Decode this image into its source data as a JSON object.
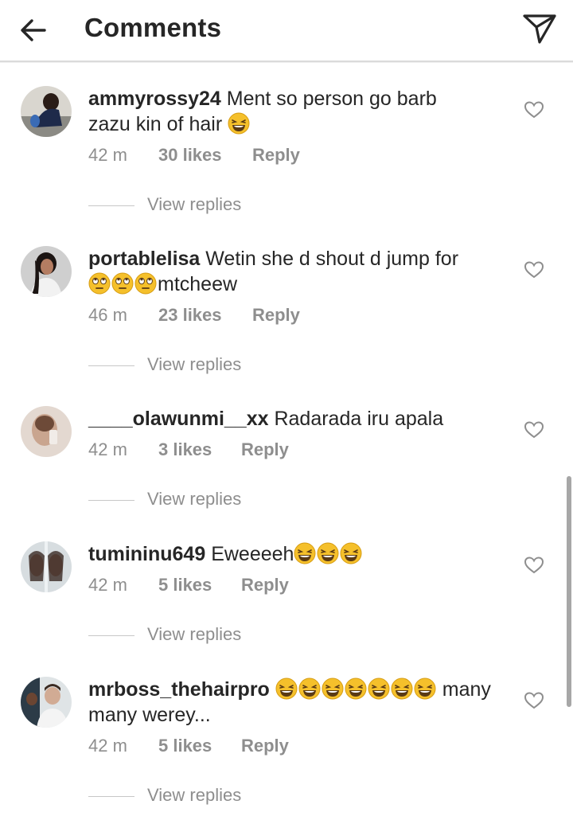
{
  "header": {
    "back_icon": "arrow-left-icon",
    "title": "Comments",
    "send_icon": "paper-plane-icon"
  },
  "comments": [
    {
      "username": "ammyrossy24",
      "text_line1": " Ment so person  go barb",
      "text_line2": "zazu  kin of hair ",
      "emojis": [
        "laughing-emoji"
      ],
      "time": "42 m",
      "likes": "30 likes",
      "reply": "Reply",
      "view_replies": "View replies"
    },
    {
      "username": "portablelisa",
      "text_line1": " Wetin she d shout d jump for",
      "text_line2": "mtcheew",
      "emojis": [
        "eye-roll-emoji",
        "eye-roll-emoji",
        "eye-roll-emoji"
      ],
      "time": "46 m",
      "likes": "23 likes",
      "reply": "Reply",
      "view_replies": "View replies"
    },
    {
      "username": "____olawunmi__xx",
      "text_line1": " Radarada iru apala",
      "time": "42 m",
      "likes": "3 likes",
      "reply": "Reply",
      "view_replies": "View replies"
    },
    {
      "username": "tumininu649",
      "text_line1": " Eweeeeh",
      "emojis": [
        "laughing-emoji",
        "laughing-emoji",
        "laughing-emoji"
      ],
      "time": "42 m",
      "likes": "5 likes",
      "reply": "Reply",
      "view_replies": "View replies"
    },
    {
      "username": "mrboss_thehairpro",
      "text_after_emojis": " many",
      "text_line2": "many werey...",
      "emojis": [
        "laughing-emoji",
        "laughing-emoji",
        "laughing-emoji",
        "laughing-emoji",
        "laughing-emoji",
        "laughing-emoji",
        "laughing-emoji"
      ],
      "time": "42 m",
      "likes": "5 likes",
      "reply": "Reply",
      "view_replies": "View replies"
    }
  ],
  "colors": {
    "text": "#262626",
    "secondary": "#8e8e8e",
    "divider": "#dbdbdb",
    "emoji": "#f5c02b"
  }
}
